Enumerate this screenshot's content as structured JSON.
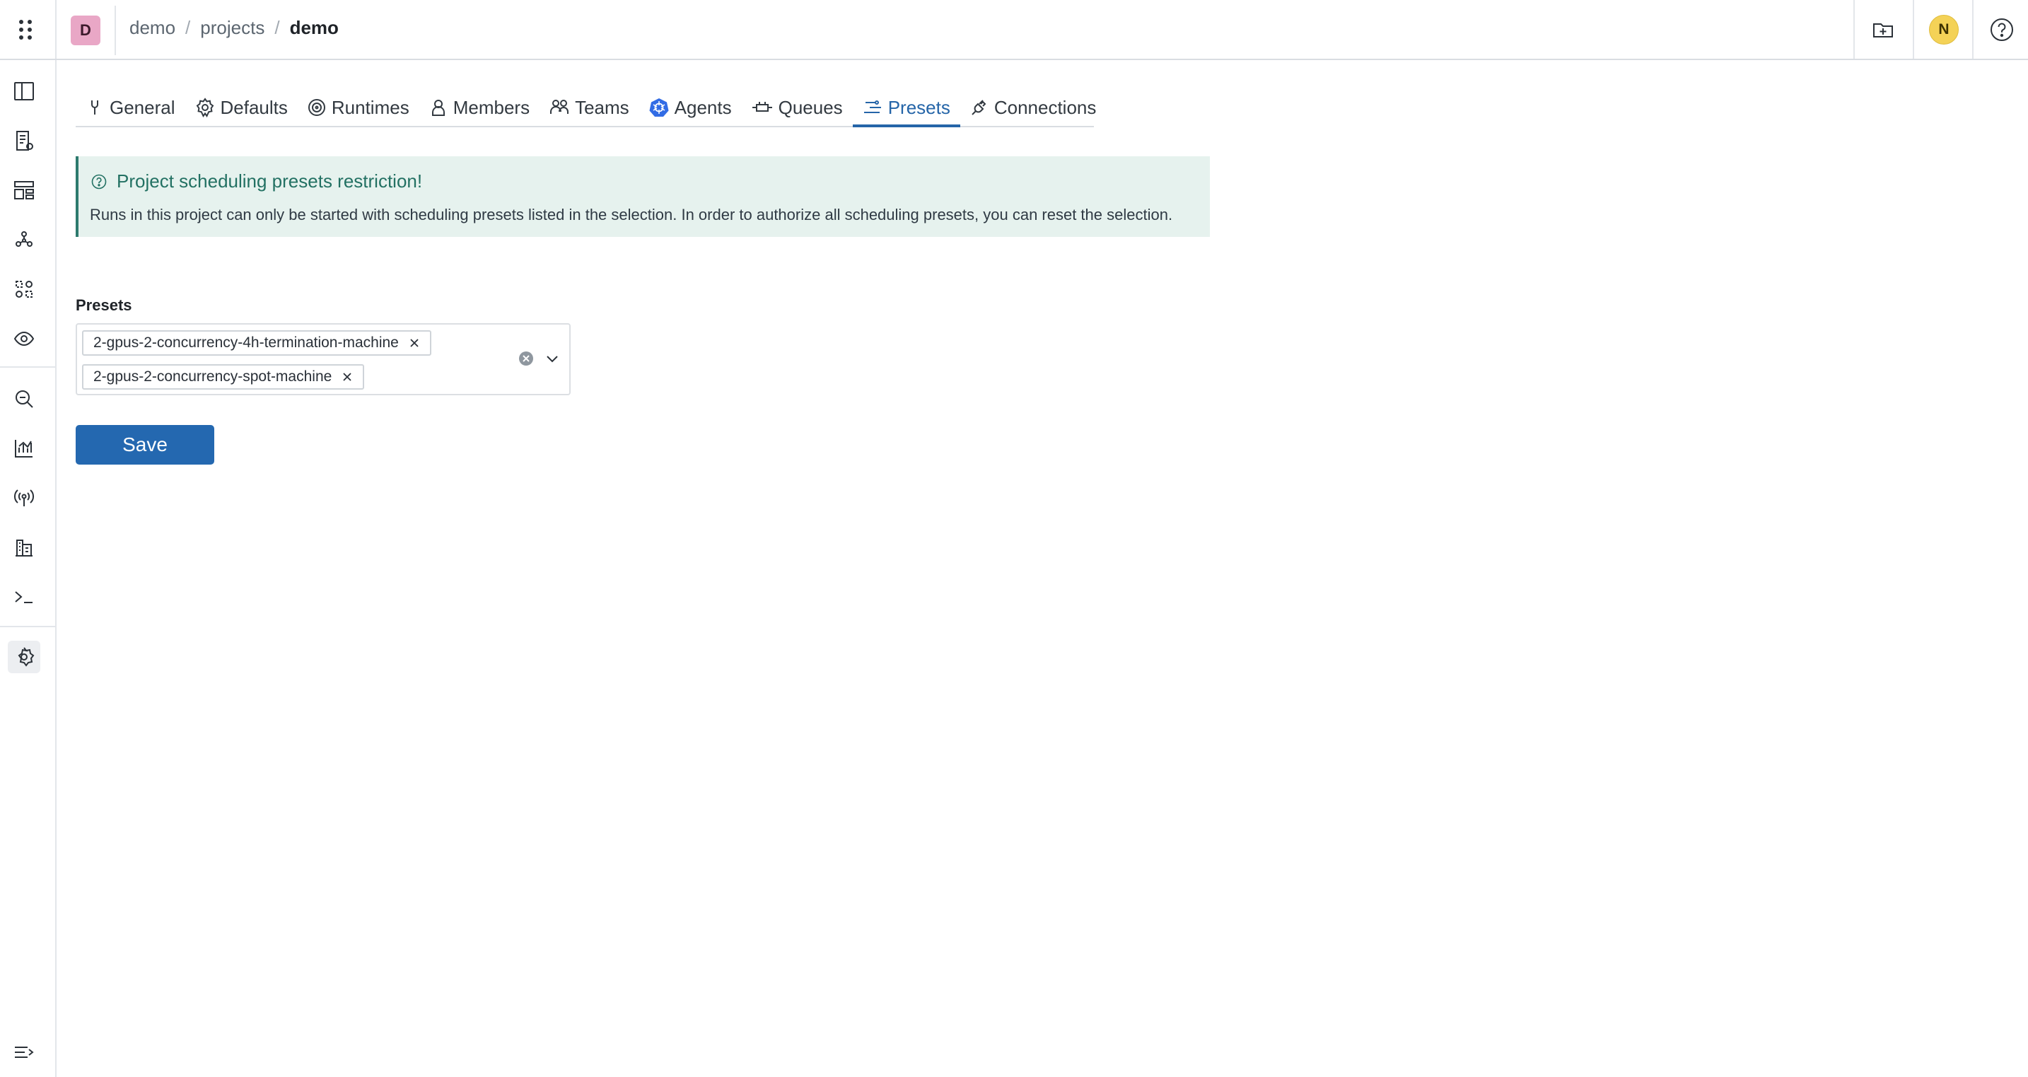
{
  "header": {
    "project_initial": "D",
    "breadcrumb": [
      {
        "label": "demo"
      },
      {
        "label": "projects"
      },
      {
        "label": "demo"
      }
    ],
    "separator": "/",
    "avatar_initial": "N"
  },
  "sidebar": {
    "items": [
      "layout-columns-icon",
      "notebook-icon",
      "dashboard-icon",
      "graph-icon",
      "component-hub-icon",
      "observation-icon",
      "search-icon",
      "analytics-icon",
      "broadcast-icon",
      "building-icon",
      "terminal-icon",
      "settings-icon",
      "collapse-icon"
    ],
    "active": "settings-icon"
  },
  "tabs": [
    {
      "label": "General",
      "icon": "general-icon"
    },
    {
      "label": "Defaults",
      "icon": "gear-icon"
    },
    {
      "label": "Runtimes",
      "icon": "target-icon"
    },
    {
      "label": "Members",
      "icon": "person-icon"
    },
    {
      "label": "Teams",
      "icon": "team-icon"
    },
    {
      "label": "Agents",
      "icon": "kubernetes-icon"
    },
    {
      "label": "Queues",
      "icon": "queue-icon"
    },
    {
      "label": "Presets",
      "icon": "presets-icon"
    },
    {
      "label": "Connections",
      "icon": "connection-icon"
    }
  ],
  "active_tab": "Presets",
  "callout": {
    "title": "Project scheduling presets restriction!",
    "text": "Runs in this project can only be started with scheduling presets listed in the selection. In order to authorize all scheduling presets, you can reset the selection."
  },
  "form": {
    "label": "Presets",
    "selected": [
      "2-gpus-2-concurrency-4h-termination-machine",
      "2-gpus-2-concurrency-spot-machine"
    ],
    "save_label": "Save"
  },
  "colors": {
    "accent": "#2565a8",
    "callout_bg": "#e6f2ee",
    "callout_text": "#237163",
    "project_badge": "#e9a7c6",
    "avatar": "#f4d257"
  }
}
